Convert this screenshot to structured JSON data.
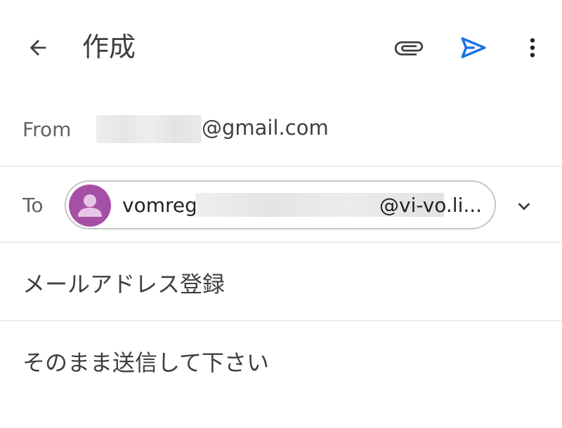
{
  "appbar": {
    "title": "作成",
    "icons": {
      "back": "arrow-back-icon",
      "attach": "paperclip-icon",
      "send": "send-icon",
      "more": "more-vert-icon"
    },
    "send_color": "#1a73e8"
  },
  "from": {
    "label": "From",
    "address_visible": "@gmail.com"
  },
  "to": {
    "label": "To",
    "chip": {
      "name_prefix": "vomreg",
      "domain": "@vi-vo.li...",
      "avatar_color": "#a64fa6"
    },
    "expand_icon": "chevron-down-icon"
  },
  "subject": {
    "value": "メールアドレス登録"
  },
  "body": {
    "value": "そのまま送信して下さい"
  }
}
